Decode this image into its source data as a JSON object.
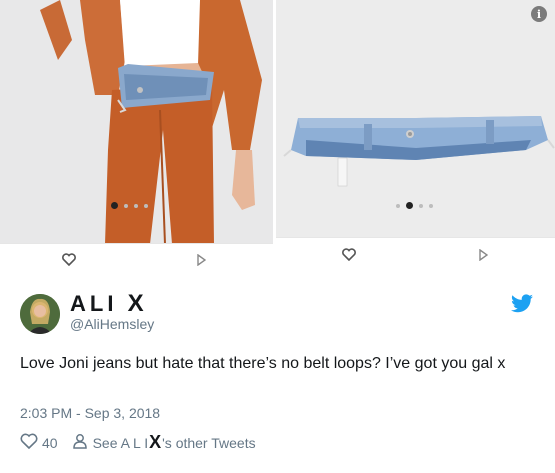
{
  "media": {
    "left_image": {
      "alt": "Model wearing orange outfit with denim waistband",
      "dots": 4,
      "active_dot": 0
    },
    "right_image": {
      "alt": "Denim waistband product photo",
      "dots": 4,
      "active_dot": 1
    },
    "info_icon": "info-icon"
  },
  "tweet": {
    "display_name": "ALI",
    "display_name_mark": "X",
    "handle": "@AliHemsley",
    "text": "Love Joni jeans but hate that there’s no belt loops? I’ve got you gal x",
    "timestamp": "2:03 PM - Sep 3, 2018",
    "like_count": "40",
    "see_other_prefix": "See A L I",
    "see_other_mark": "X",
    "see_other_suffix": "'s other Tweets"
  },
  "colors": {
    "text": "#14171a",
    "secondary": "#657786",
    "twitter_blue": "#1da1f2",
    "jacket_orange": "#c8642e",
    "denim": "#7f9fc4"
  }
}
